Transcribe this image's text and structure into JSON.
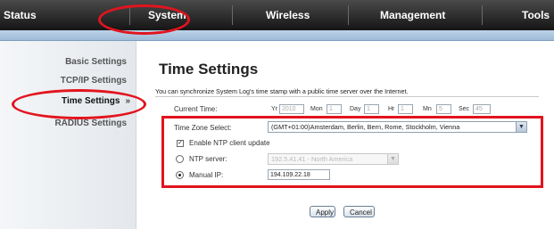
{
  "nav": {
    "items": [
      "Status",
      "System",
      "Wireless",
      "Management",
      "Tools"
    ],
    "active": "System"
  },
  "sidebar": {
    "items": [
      {
        "label": "Basic Settings"
      },
      {
        "label": "TCP/IP Settings"
      },
      {
        "label": "Time Settings",
        "arrow": "»"
      },
      {
        "label": "RADIUS Settings"
      }
    ],
    "active": "Time Settings"
  },
  "page": {
    "title": "Time Settings",
    "description": "You can synchronize System Log's time stamp with a public time server over the Internet."
  },
  "current_time": {
    "label": "Current Time:",
    "yr_label": "Yr",
    "yr": "2010",
    "mon_label": "Mon",
    "mon": "1",
    "day_label": "Day",
    "day": "1",
    "hr_label": "Hr",
    "hr": "1",
    "mn_label": "Mn",
    "mn": "5",
    "sec_label": "Sec",
    "sec": "45"
  },
  "timezone": {
    "label": "Time Zone Select:",
    "value": "(GMT+01:00)Amsterdam, Berlin, Bern, Rome, Stockholm, Vienna"
  },
  "ntp": {
    "enable_label": "Enable NTP client update",
    "enabled": true,
    "server_label": "NTP server:",
    "server_value": "192.5.41.41 - North America",
    "manual_label": "Manual IP:",
    "manual_value": "194.109.22.18",
    "selected": "manual"
  },
  "buttons": {
    "apply": "Apply",
    "cancel": "Cancel"
  },
  "icons": {
    "dropdown": "chevron-down-icon",
    "active_arrow": "double-chevron-right-icon"
  },
  "colors": {
    "annotation": "#e2141e",
    "nav_bg": "#2a2a2a",
    "subbar": "#abc4df"
  }
}
